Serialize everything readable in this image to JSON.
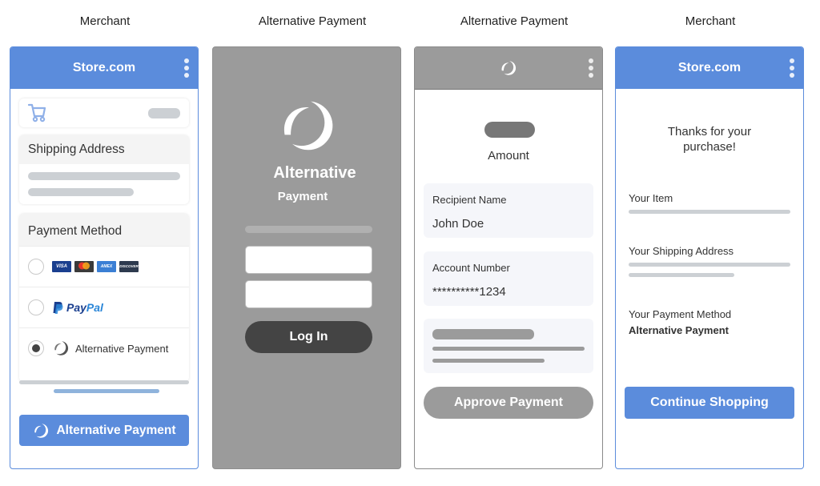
{
  "columns": [
    {
      "title": "Merchant"
    },
    {
      "title": "Alternative Payment"
    },
    {
      "title": "Alternative Payment"
    },
    {
      "title": "Merchant"
    }
  ],
  "colors": {
    "merchant_blue": "#5b8cdc",
    "alt_gray": "#9b9b9b",
    "login_dark": "#444444",
    "placeholder_gray": "#ccd0d4"
  },
  "screen1": {
    "header_title": "Store.com",
    "cart_icon": "cart-icon",
    "shipping_heading": "Shipping Address",
    "payment_heading": "Payment Method",
    "payment_options": [
      {
        "type": "cards",
        "cards": [
          "VISA",
          "MC",
          "AMEX",
          "DISCOVER"
        ],
        "selected": false
      },
      {
        "type": "paypal",
        "label_pay": "Pay",
        "label_pal": "Pal",
        "selected": false
      },
      {
        "type": "alternative",
        "label": "Alternative Payment",
        "selected": true
      }
    ],
    "pay_button_label": "Alternative Payment"
  },
  "screen2": {
    "brand_line1": "Alternative",
    "brand_line2": "Payment",
    "login_button_label": "Log In"
  },
  "screen3": {
    "amount_label": "Amount",
    "recipient_label": "Recipient Name",
    "recipient_value": "John Doe",
    "account_label": "Account Number",
    "account_value": "**********1234",
    "approve_button_label": "Approve Payment"
  },
  "screen4": {
    "header_title": "Store.com",
    "thanks_line1": "Thanks for your",
    "thanks_line2": "purchase!",
    "item_label": "Your Item",
    "shipping_label": "Your Shipping Address",
    "payment_label": "Your Payment Method",
    "payment_value": "Alternative Payment",
    "continue_button_label": "Continue Shopping"
  }
}
